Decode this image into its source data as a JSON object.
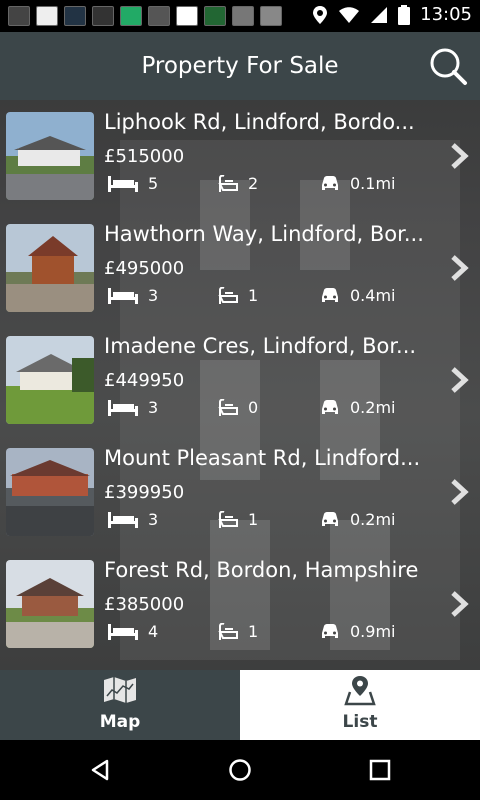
{
  "status_bar": {
    "time": "13:05",
    "notification_icons": [
      "app-icon-1",
      "app-icon-2",
      "app-icon-3",
      "app-icon-4",
      "app-icon-5",
      "image-icon",
      "app-icon-6",
      "app-icon-7",
      "download-icon",
      "clipboard-icon"
    ],
    "system_icons": [
      "location-icon",
      "wifi-icon",
      "signal-icon",
      "battery-icon"
    ]
  },
  "header": {
    "title": "Property For Sale",
    "search_icon": "search-icon"
  },
  "listings": [
    {
      "title": "Liphook Rd, Lindford, Bordo...",
      "price": "£515000",
      "beds": "5",
      "baths": "2",
      "distance": "0.1mi"
    },
    {
      "title": "Hawthorn Way, Lindford, Bor...",
      "price": "£495000",
      "beds": "3",
      "baths": "1",
      "distance": "0.4mi"
    },
    {
      "title": "Imadene Cres, Lindford, Bor...",
      "price": "£449950",
      "beds": "3",
      "baths": "0",
      "distance": "0.2mi"
    },
    {
      "title": "Mount Pleasant Rd, Lindford...",
      "price": "£399950",
      "beds": "3",
      "baths": "1",
      "distance": "0.2mi"
    },
    {
      "title": "Forest Rd, Bordon, Hampshire",
      "price": "£385000",
      "beds": "4",
      "baths": "1",
      "distance": "0.9mi"
    }
  ],
  "bottom_tabs": [
    {
      "label": "Map",
      "icon": "map-icon",
      "selected": false
    },
    {
      "label": "List",
      "icon": "list-location-icon",
      "selected": true
    }
  ],
  "colors": {
    "header_bg": "#3c4649",
    "tab_selected_bg": "#ffffff"
  }
}
